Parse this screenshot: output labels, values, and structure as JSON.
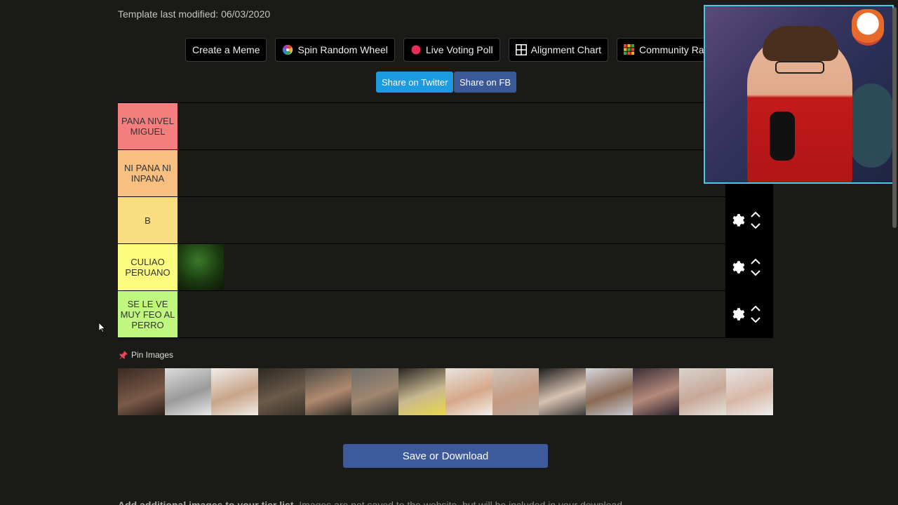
{
  "header": {
    "modified": "Template last modified: 06/03/2020"
  },
  "toolbar": [
    {
      "label": "Create a Meme",
      "icon": ""
    },
    {
      "label": "Spin Random Wheel",
      "icon": "wheel-icon"
    },
    {
      "label": "Live Voting Poll",
      "icon": "red-dot-icon"
    },
    {
      "label": "Alignment Chart",
      "icon": "grid-icon"
    },
    {
      "label": "Community Rank",
      "icon": "color-grid-icon"
    }
  ],
  "share": {
    "twitter": "Share on Twitter",
    "facebook": "Share on FB"
  },
  "tiers": [
    {
      "label": "PANA NIVEL MIGUEL",
      "color": "#f57f7f"
    },
    {
      "label": "NI PANA NI INPANA",
      "color": "#f7bf80"
    },
    {
      "label": "B",
      "color": "#f8de80"
    },
    {
      "label": "CULIAO PERUANO",
      "color": "#fdfc7f"
    },
    {
      "label": "SE LE VE MUY FEO AL PERRO",
      "color": "#bff77f"
    }
  ],
  "pin": {
    "label": "Pin Images"
  },
  "save": {
    "label": "Save or Download"
  },
  "footer": {
    "bold": "Add additional images to your tier list.",
    "rest": " Images are not saved to the website, but will be included in your download."
  },
  "colors": {
    "twitter": "#1d9be0",
    "facebook": "#3b5998",
    "save": "#3d5a9c",
    "webcam_border": "#4bc8e8"
  }
}
